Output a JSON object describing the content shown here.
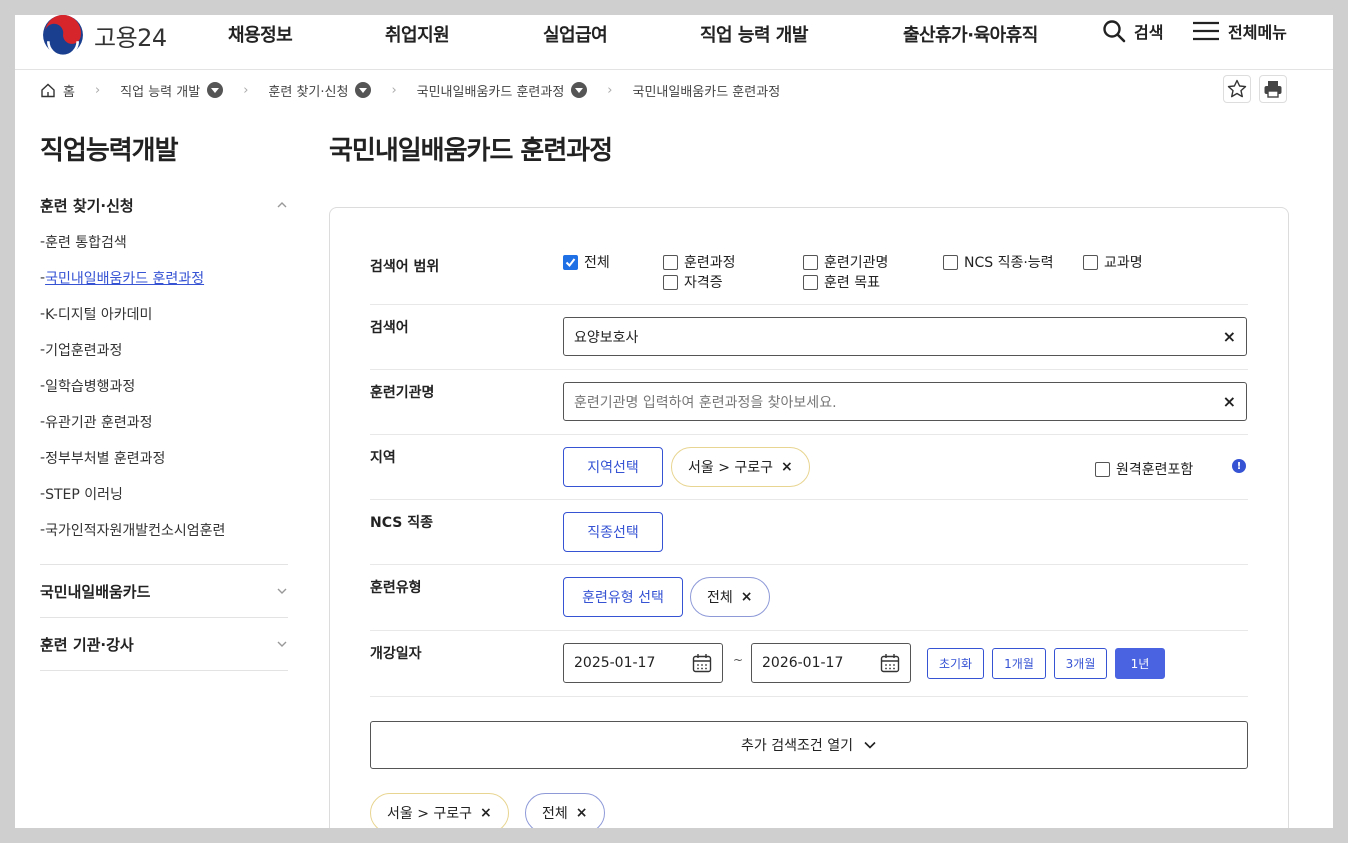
{
  "header": {
    "logo_text": "고용24",
    "nav": [
      "채용정보",
      "취업지원",
      "실업급여",
      "직업 능력 개발",
      "출산휴가·육아휴직"
    ],
    "search_label": "검색",
    "menu_label": "전체메뉴"
  },
  "breadcrumb": {
    "home": "홈",
    "items": [
      "직업 능력 개발",
      "훈련 찾기·신청",
      "국민내일배움카드 훈련과정",
      "국민내일배움카드 훈련과정"
    ]
  },
  "sidebar": {
    "title": "직업능력개발",
    "group1": {
      "title": "훈련 찾기·신청",
      "items": [
        "훈련 통합검색",
        "국민내일배움카드 훈련과정",
        "K-디지털 아카데미",
        "기업훈련과정",
        "일학습병행과정",
        "유관기관 훈련과정",
        "정부부처별 훈련과정",
        "STEP 이러닝",
        "국가인적자원개발컨소시엄훈련"
      ]
    },
    "group2": {
      "title": "국민내일배움카드"
    },
    "group3": {
      "title": "훈련 기관·강사"
    }
  },
  "main": {
    "title": "국민내일배움카드 훈련과정",
    "scope": {
      "label": "검색어 범위",
      "options": [
        "전체",
        "훈련과정",
        "훈련기관명",
        "NCS 직종·능력",
        "교과명",
        "자격증",
        "훈련 목표"
      ]
    },
    "keyword": {
      "label": "검색어",
      "value": "요양보호사"
    },
    "institution": {
      "label": "훈련기관명",
      "placeholder": "훈련기관명 입력하여 훈련과정을 찾아보세요."
    },
    "region": {
      "label": "지역",
      "button": "지역선택",
      "chip": "서울 > 구로구",
      "remote": "원격훈련포함"
    },
    "ncs": {
      "label": "NCS 직종",
      "button": "직종선택"
    },
    "type": {
      "label": "훈련유형",
      "button": "훈련유형 선택",
      "chip": "전체"
    },
    "date": {
      "label": "개강일자",
      "start": "2025-01-17",
      "sep": "~",
      "end": "2026-01-17",
      "buttons": [
        "초기화",
        "1개월",
        "3개월",
        "1년"
      ]
    },
    "more": "추가 검색조건 열기",
    "selected_chips": [
      "서울 > 구로구",
      "전체"
    ]
  }
}
